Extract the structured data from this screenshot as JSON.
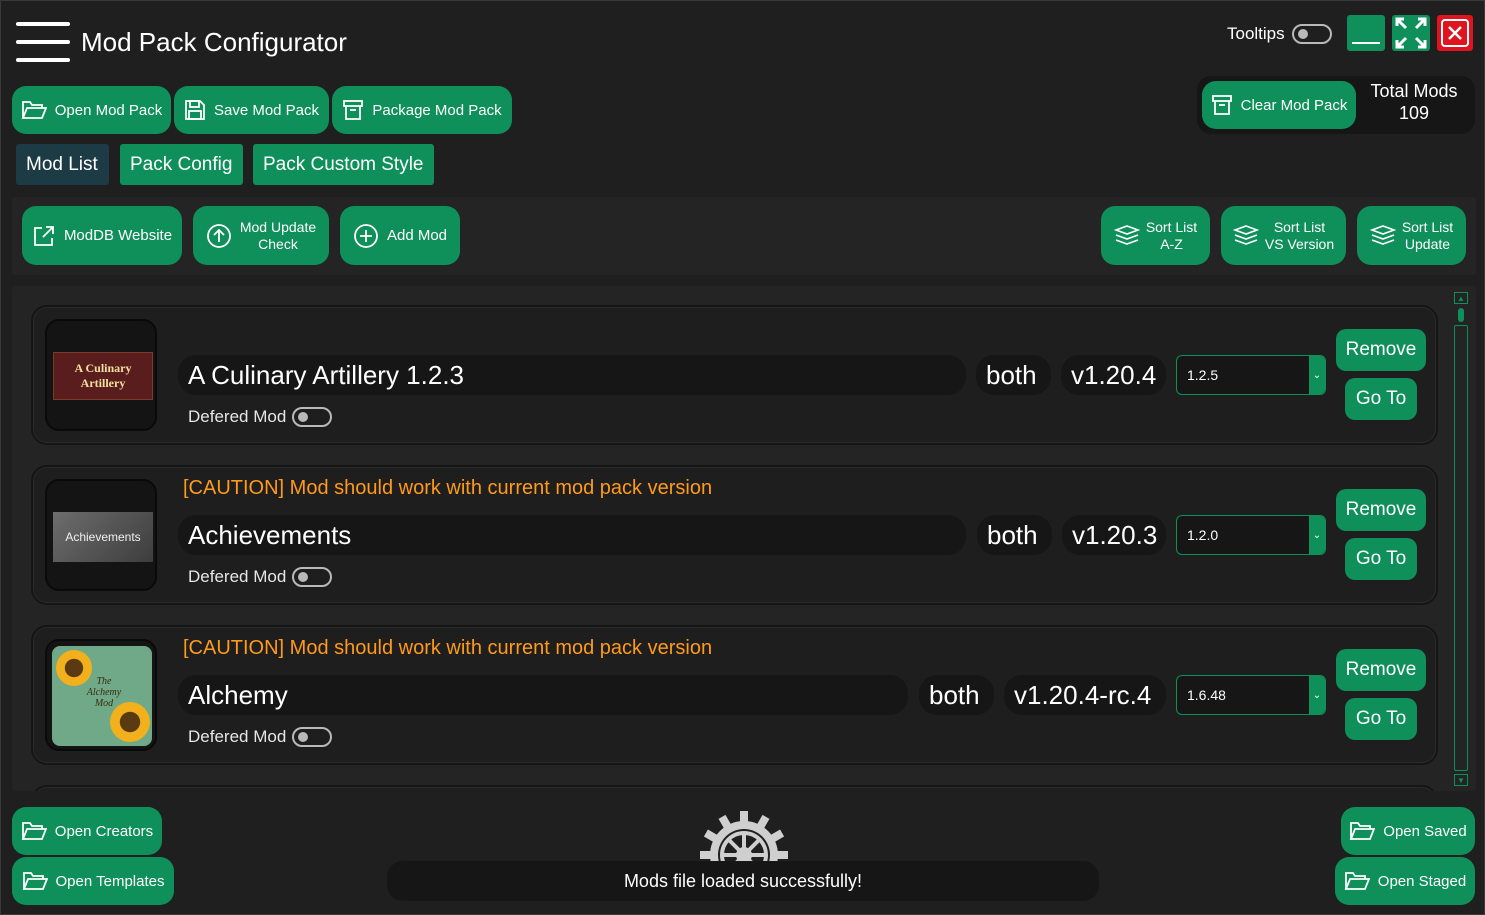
{
  "header": {
    "title": "Mod Pack Configurator",
    "tooltips_label": "Tooltips",
    "total_mods_label": "Total Mods",
    "total_mods_count": "109"
  },
  "toolbar": {
    "open_label": "Open Mod Pack",
    "save_label": "Save Mod Pack",
    "package_label": "Package Mod Pack",
    "clear_label": "Clear Mod Pack"
  },
  "tabs": [
    {
      "label": "Mod List",
      "active": true
    },
    {
      "label": "Pack Config",
      "active": false
    },
    {
      "label": "Pack Custom Style",
      "active": false
    }
  ],
  "actions": {
    "moddb_label": "ModDB Website",
    "update_check_line1": "Mod Update",
    "update_check_line2": "Check",
    "add_mod_label": "Add Mod",
    "sort_az_line1": "Sort List",
    "sort_az_line2": "A-Z",
    "sort_vs_line1": "Sort List",
    "sort_vs_line2": "VS Version",
    "sort_update_line1": "Sort List",
    "sort_update_line2": "Update"
  },
  "mods": [
    {
      "name": "A Culinary Artillery 1.2.3",
      "side": "both",
      "game_version": "v1.20.4",
      "selected_version": "1.2.5",
      "caution": "",
      "defered_label": "Defered Mod",
      "remove_label": "Remove",
      "goto_label": "Go To",
      "thumb_text_1": "A Culinary",
      "thumb_text_2": "Artillery"
    },
    {
      "name": "Achievements",
      "side": "both",
      "game_version": "v1.20.3",
      "selected_version": "1.2.0",
      "caution": "[CAUTION] Mod should work with current mod pack version",
      "defered_label": "Defered Mod",
      "remove_label": "Remove",
      "goto_label": "Go To",
      "thumb_text_1": "Achievements"
    },
    {
      "name": "Alchemy",
      "side": "both",
      "game_version": "v1.20.4-rc.4",
      "selected_version": "1.6.48",
      "caution": "[CAUTION] Mod should work with current mod pack version",
      "defered_label": "Defered Mod",
      "remove_label": "Remove",
      "goto_label": "Go To",
      "thumb_text_1": "The",
      "thumb_text_2": "Alchemy",
      "thumb_text_3": "Mod"
    }
  ],
  "footer": {
    "open_creators_label": "Open Creators",
    "open_templates_label": "Open Templates",
    "open_saved_label": "Open Saved",
    "open_staged_label": "Open Staged",
    "status_message": "Mods file loaded successfully!"
  },
  "colors": {
    "accent_green": "#0f8f5a",
    "active_tab": "#1c3b45",
    "caution": "#ff9a1a",
    "close_red": "#e0141e"
  }
}
